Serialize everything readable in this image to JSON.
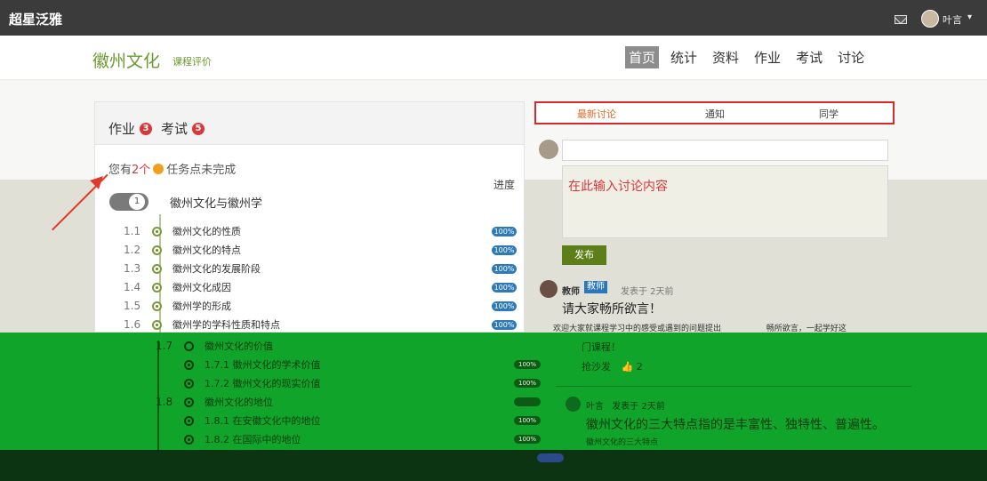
{
  "topbar": {
    "brand": "超星泛雅",
    "user": "叶言"
  },
  "header": {
    "course_title": "徽州文化",
    "course_sub": "课程评价",
    "nav": [
      "首页",
      "统计",
      "资料",
      "作业",
      "考试",
      "讨论"
    ]
  },
  "left": {
    "tab_homework": "作业",
    "homework_count": "3",
    "tab_exam": "考试",
    "exam_count": "5",
    "unfinished_pre": "您有",
    "unfinished_num": "2个",
    "unfinished_post": "任务点未完成",
    "progress_label": "进度",
    "chapter_num": "1",
    "chapter_title": "徽州文化与徽州学",
    "sections": [
      {
        "num": "1.1",
        "label": "徽州文化的性质",
        "badge": "100%"
      },
      {
        "num": "1.2",
        "label": "徽州文化的特点",
        "badge": "100%"
      },
      {
        "num": "1.3",
        "label": "徽州文化的发展阶段",
        "badge": "100%"
      },
      {
        "num": "1.4",
        "label": "徽州文化成因",
        "badge": "100%"
      },
      {
        "num": "1.5",
        "label": "徽州学的形成",
        "badge": "100%"
      },
      {
        "num": "1.6",
        "label": "徽州学的学科性质和特点",
        "badge": "100%"
      }
    ],
    "green_sections": [
      {
        "num": "1.7",
        "label": "徽州文化的价值",
        "badge": ""
      },
      {
        "num": "",
        "label": "1.7.1 徽州文化的学术价值",
        "badge": "100%"
      },
      {
        "num": "",
        "label": "1.7.2 徽州文化的现实价值",
        "badge": "100%"
      },
      {
        "num": "1.8",
        "label": "徽州文化的地位",
        "badge": ""
      },
      {
        "num": "",
        "label": "1.8.1 在安徽文化中的地位",
        "badge": "100%"
      },
      {
        "num": "",
        "label": "1.8.2 在国际中的地位",
        "badge": "100%"
      }
    ]
  },
  "right": {
    "tabs": [
      "最新讨论",
      "通知",
      "同学"
    ],
    "content_placeholder": "在此输入讨论内容",
    "post_button": "发布",
    "post1": {
      "author": "教师",
      "badge": "教师",
      "time": "发表于 2天前",
      "title": "请大家畅所欲言！",
      "body": "欢迎大家就课程学习中的感受或遇到的问题提出",
      "body_end": "畅所欲言，一起学好这",
      "body2": "门课程！",
      "reply": "抢沙发",
      "likes": "2"
    },
    "post2": {
      "author": "叶言",
      "time": "发表于 2天前",
      "title": "徽州文化的三大特点指的是丰富性、独特性、普遍性。",
      "body": "徽州文化的三大特点"
    }
  }
}
